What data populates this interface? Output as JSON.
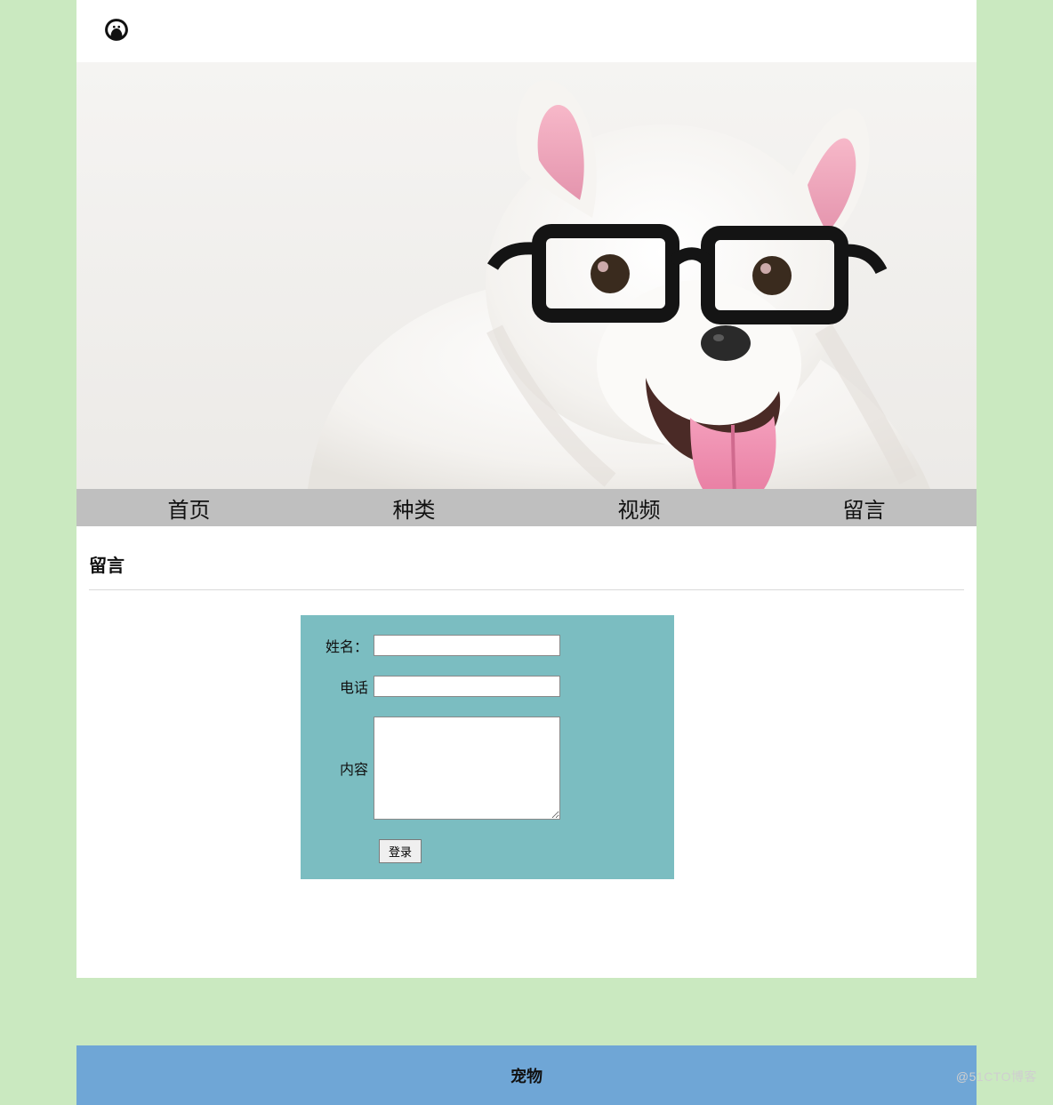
{
  "logo": {
    "name": "pet-hands-logo"
  },
  "nav": {
    "items": [
      {
        "label": "首页",
        "name": "nav-home"
      },
      {
        "label": "种类",
        "name": "nav-category"
      },
      {
        "label": "视频",
        "name": "nav-video"
      },
      {
        "label": "留言",
        "name": "nav-message"
      }
    ]
  },
  "section": {
    "title": "留言"
  },
  "form": {
    "name_label": "姓名：",
    "phone_label": "电话",
    "content_label": "内容",
    "name_value": "",
    "phone_value": "",
    "content_value": "",
    "submit_label": "登录"
  },
  "footer": {
    "text": "宠物"
  },
  "hero": {
    "alt": "white-dog-with-glasses"
  },
  "watermark": "@51CTO博客",
  "colors": {
    "page_bg": "#cae9c0",
    "nav_bg": "#bfbfbf",
    "card_bg": "#7bbdc1",
    "footer_bg": "#6fa6d6"
  }
}
